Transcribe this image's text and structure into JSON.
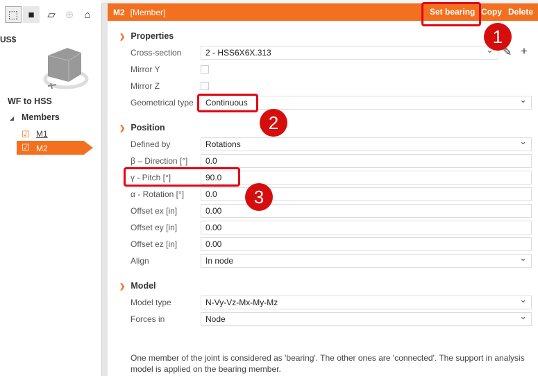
{
  "toolbar": {
    "icons": [
      "wireframe-view-icon",
      "solid-view-icon",
      "member-view-icon",
      "axis-rotate-icon",
      "home-icon"
    ]
  },
  "left": {
    "project_title": "US$",
    "tree_root": "WF to HSS",
    "group": "Members",
    "members": [
      {
        "label": "M1",
        "selected": false
      },
      {
        "label": "M2",
        "selected": true
      }
    ]
  },
  "header": {
    "title": "M2",
    "subtitle": "[Member]",
    "set_bearing": "Set bearing",
    "copy": "Copy",
    "delete": "Delete"
  },
  "properties": {
    "title": "Properties",
    "cross_section_label": "Cross-section",
    "cross_section": "2 - HSS6X6X.313",
    "mirror_y_label": "Mirror Y",
    "mirror_z_label": "Mirror Z",
    "geom_type_label": "Geometrical type",
    "geom_type": "Continuous"
  },
  "position": {
    "title": "Position",
    "defined_by_label": "Defined by",
    "defined_by": "Rotations",
    "beta_label": "β – Direction [°]",
    "beta": "0.0",
    "gamma_label": "γ - Pitch [°]",
    "gamma": "90.0",
    "alpha_label": "α - Rotation [°]",
    "alpha": "0.0",
    "ex_label": "Offset ex [in]",
    "ex": "0.00",
    "ey_label": "Offset ey [in]",
    "ey": "0.00",
    "ez_label": "Offset ez [in]",
    "ez": "0.00",
    "align_label": "Align",
    "align": "In node"
  },
  "model": {
    "title": "Model",
    "model_type_label": "Model type",
    "model_type": "N-Vy-Vz-Mx-My-Mz",
    "forces_in_label": "Forces in",
    "forces_in": "Node"
  },
  "note": "One member of the joint is considered as 'bearing'. The other ones are 'connected'. The support in analysis model is applied on the bearing member.",
  "badges": [
    "1",
    "2",
    "3"
  ],
  "colors": {
    "accent": "#f37021",
    "annotation": "#e30613"
  }
}
